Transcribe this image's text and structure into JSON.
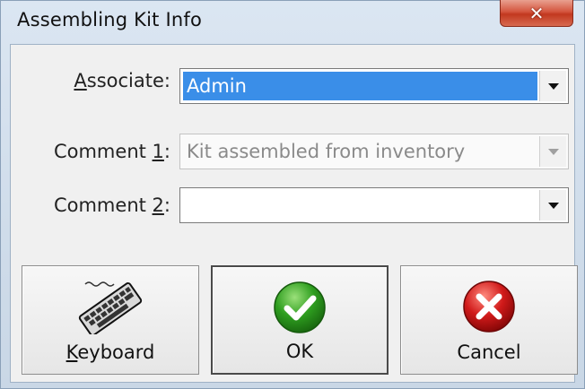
{
  "window": {
    "title": "Assembling Kit Info",
    "close_glyph": "✕"
  },
  "form": {
    "associate": {
      "label_prefix": "",
      "label_underline": "A",
      "label_suffix": "ssociate:",
      "value": "Admin"
    },
    "comment1": {
      "label_prefix": "Comment ",
      "label_underline": "1",
      "label_suffix": ":",
      "value": "Kit assembled from inventory",
      "disabled": true
    },
    "comment2": {
      "label_prefix": "Comment ",
      "label_underline": "2",
      "label_suffix": ":",
      "value": ""
    }
  },
  "buttons": {
    "keyboard": {
      "underline": "K",
      "rest": "eyboard",
      "icon": "keyboard-icon"
    },
    "ok": {
      "label": "OK",
      "icon": "check-icon",
      "color": "#2e9e1f"
    },
    "cancel": {
      "label": "Cancel",
      "icon": "cancel-x-icon",
      "color": "#d11a1a"
    }
  }
}
